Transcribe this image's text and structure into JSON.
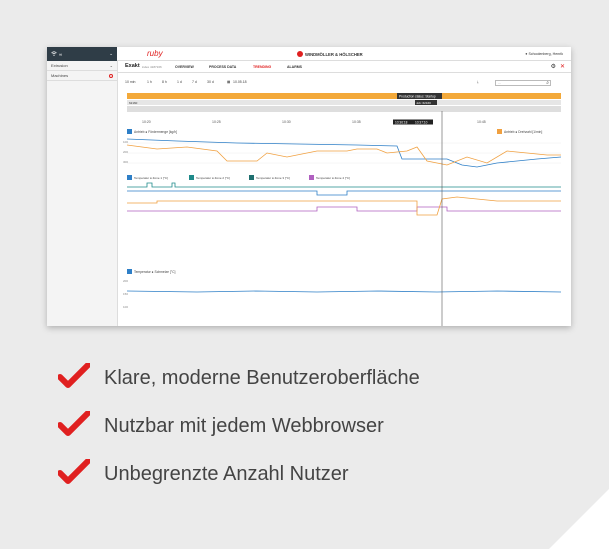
{
  "screenshot": {
    "sidebar": {
      "top_label": "∞",
      "items": [
        {
          "label": "Extrusion",
          "marker": "chevron"
        },
        {
          "label": "Machines",
          "marker": "dot"
        }
      ]
    },
    "topbar": {
      "app_logo": "ruby",
      "brand": "WINDMÖLLER & HÖLSCHER",
      "user": "Schoolenberg, Henrik"
    },
    "nav": {
      "title": "Exakt",
      "subtitle": "index 4187166",
      "tabs": [
        "OVERVIEW",
        "PROCESS DATA",
        "TRENDING",
        "ALARMS"
      ],
      "active_tab": "TRENDING"
    },
    "timebar": {
      "ranges": [
        "10 min",
        "1 h",
        "8 h",
        "1 d",
        "7 d",
        "30 d"
      ],
      "date": "10.05.18",
      "search_placeholder": "...",
      "status_label": "Production status: Startup",
      "job_label": "Job: 62160",
      "row_label": "62160",
      "times": [
        "10:20",
        "10:25",
        "10:30",
        "10:35",
        "10:40",
        "10:45"
      ],
      "cursor_time": "10:36:18",
      "cursor_time2": "10:37:10"
    },
    "panels": [
      {
        "legend": "Antrieb ● Fördermenge [kg/h]",
        "legend_right": "Antrieb ● Drehzahl [1/min]"
      },
      {
        "legend": [
          "Temperatur ● Zone 1 [°C]",
          "Temperatur ● Zone 2 [°C]",
          "Temperatur ● Zone 3 [°C]",
          "Temperatur ● Zone 4 [°C]"
        ]
      },
      {
        "legend": "Temperatur ● Schmelze [°C]"
      }
    ],
    "colors": {
      "blue": "#2e7fc7",
      "orange": "#f0a040",
      "teal": "#1f8a8a",
      "purple": "#b060c0",
      "red": "#e02020",
      "status_bar": "#f3a93a"
    }
  },
  "features": [
    "Klare, moderne Benutzeroberfläche",
    "Nutzbar mit jedem Webbrowser",
    "Unbegrenzte Anzahl Nutzer"
  ]
}
